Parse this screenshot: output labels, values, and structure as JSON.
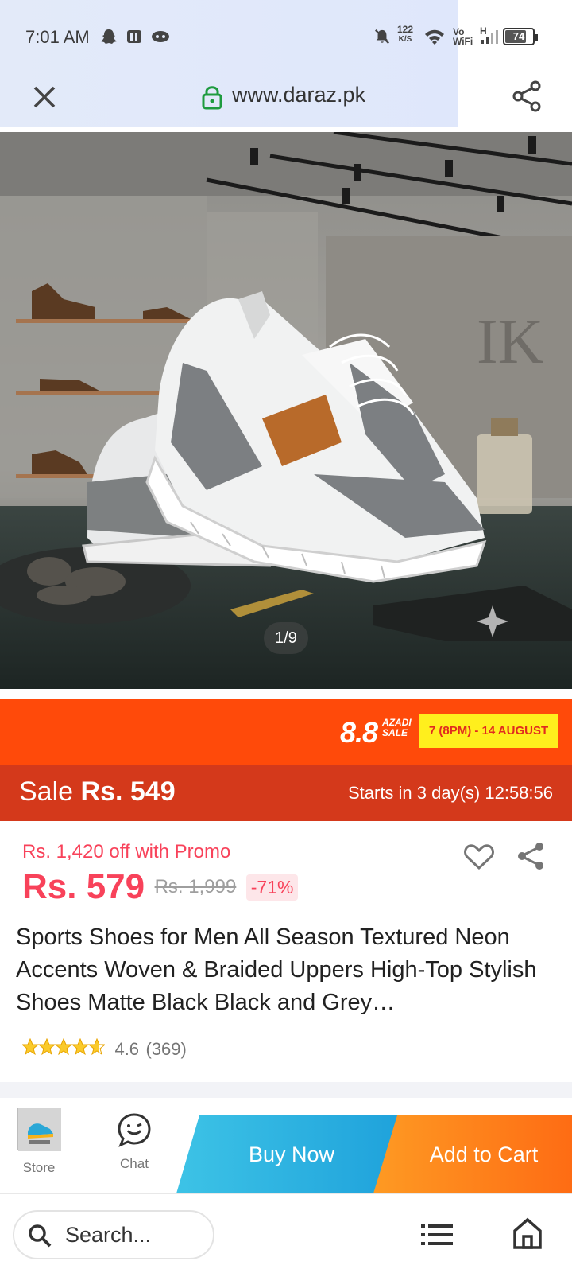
{
  "status_bar": {
    "time": "7:01 AM",
    "speed_value": "122",
    "speed_unit": "K/S",
    "vowifi_top": "Vo",
    "vowifi_bottom": "WiFi",
    "network": "H",
    "battery": "74"
  },
  "browser": {
    "url": "www.daraz.pk"
  },
  "gallery": {
    "counter": "1/9"
  },
  "campaign": {
    "number": "8.8",
    "name_line1": "AZADI",
    "name_line2": "SALE",
    "dates": "7 (8PM) - 14 AUGUST",
    "sale_label": "Sale",
    "sale_price": "Rs. 549",
    "starts": "Starts in 3 day(s) 12:58:56"
  },
  "product": {
    "promo": "Rs. 1,420 off with Promo",
    "price": "Rs. 579",
    "original_price": "Rs. 1,999",
    "discount": "-71%",
    "title": "Sports Shoes for Men All Season Textured Neon Accents Woven & Braided Uppers High-Top Stylish Shoes Matte Black Black and Grey…",
    "rating": "4.6",
    "reviews": "(369)",
    "stars": 4.6
  },
  "actions": {
    "store_label": "Store",
    "chat_label": "Chat",
    "buy_now": "Buy Now",
    "add_to_cart": "Add to Cart"
  },
  "bottom_bar": {
    "search_placeholder": "Search..."
  },
  "colors": {
    "accent": "#f8425a",
    "campaign": "#ff4a0a",
    "salebar": "#d4391b",
    "buy": "#1ea1db",
    "cart": "#fe6c14"
  }
}
